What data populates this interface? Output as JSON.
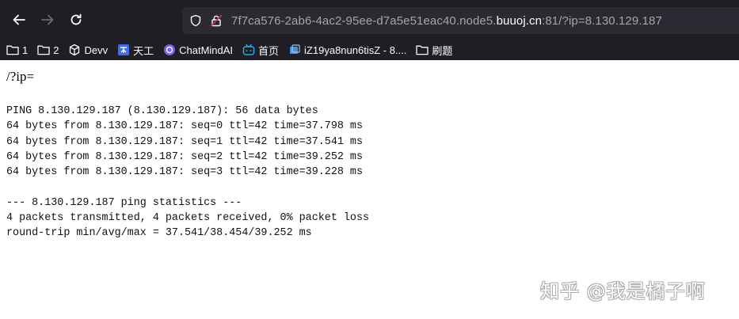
{
  "browser": {
    "url_prefix": "7f7ca576-2ab6-4ac2-95ee-d7a5e51eac40.node5.",
    "url_domain": "buuoj.cn",
    "url_suffix": ":81/?ip=8.130.129.187"
  },
  "bookmarks": [
    {
      "label": "1",
      "icon": "folder-icon"
    },
    {
      "label": "2",
      "icon": "folder-icon"
    },
    {
      "label": "Devv",
      "icon": "cube-icon"
    },
    {
      "label": "天工",
      "icon": "tiangong-icon"
    },
    {
      "label": "ChatMindAI",
      "icon": "chatmind-icon"
    },
    {
      "label": "首页",
      "icon": "bilibili-icon"
    },
    {
      "label": "iZ19ya8nun6tisZ - 8....",
      "icon": "server-icon"
    },
    {
      "label": "刷题",
      "icon": "folder-icon"
    }
  ],
  "page": {
    "query": "/?ip=",
    "output_lines": [
      "PING 8.130.129.187 (8.130.129.187): 56 data bytes",
      "64 bytes from 8.130.129.187: seq=0 ttl=42 time=37.798 ms",
      "64 bytes from 8.130.129.187: seq=1 ttl=42 time=37.541 ms",
      "64 bytes from 8.130.129.187: seq=2 ttl=42 time=39.252 ms",
      "64 bytes from 8.130.129.187: seq=3 ttl=42 time=39.228 ms",
      "",
      "--- 8.130.129.187 ping statistics ---",
      "4 packets transmitted, 4 packets received, 0% packet loss",
      "round-trip min/avg/max = 37.541/38.454/39.252 ms"
    ]
  },
  "watermark": "知乎 @我是橘子啊",
  "colors": {
    "toolbar_bg": "#1f1e25",
    "urlbar_bg": "#2b2a33",
    "text_light": "#fbfbfe",
    "text_dim": "#a5a4aa"
  }
}
